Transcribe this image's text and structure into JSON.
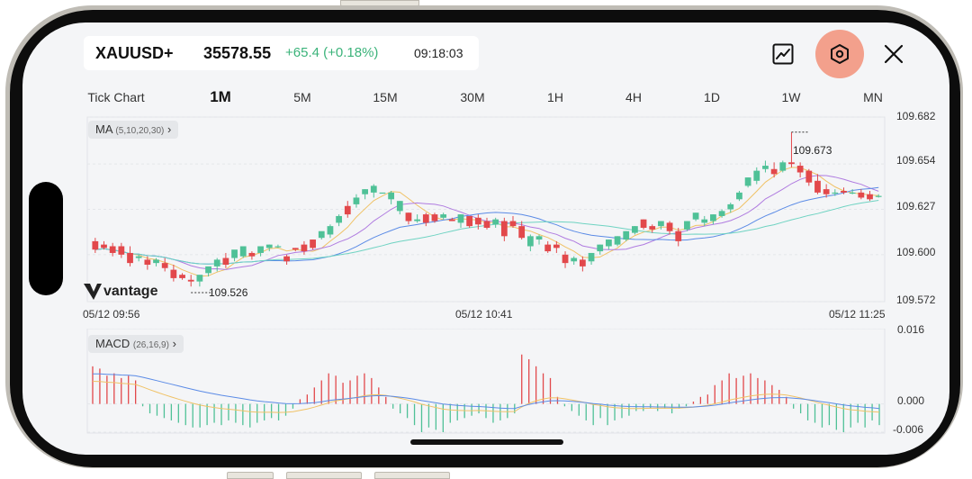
{
  "header": {
    "symbol": "XAUUSD+",
    "price": "35578.55",
    "change": "+65.4 (+0.18%)",
    "time": "09:18:03",
    "change_color": "#3bb37a"
  },
  "toolbar": {
    "chart_icon": "line-chart-icon",
    "settings_icon": "hexagon-settings-icon",
    "close_icon": "close-icon",
    "settings_highlight_color": "#f3a08c"
  },
  "timeframes": {
    "items": [
      "Tick Chart",
      "1M",
      "5M",
      "15M",
      "30M",
      "1H",
      "4H",
      "1D",
      "1W",
      "MN"
    ],
    "active": "1M"
  },
  "main_chart": {
    "indicator_name": "MA",
    "indicator_params": "(5,10,20,30)",
    "watermark": "vantage",
    "high_label": "109.673",
    "low_label": "109.526",
    "price_axis": [
      "109.682",
      "109.654",
      "109.627",
      "109.600",
      "109.572"
    ],
    "time_axis": [
      "05/12 09:56",
      "05/12 10:41",
      "05/12 11:25"
    ],
    "up_color": "#4fc197",
    "down_color": "#e2484b"
  },
  "macd_chart": {
    "indicator_name": "MACD",
    "indicator_params": "(26,16,9)",
    "axis": [
      "0.016",
      "0.000",
      "-0.006"
    ]
  },
  "chart_data": [
    {
      "type": "candlestick",
      "title": "",
      "y_ticks": [
        109.682,
        109.654,
        109.627,
        109.6,
        109.572
      ],
      "ylim": [
        109.572,
        109.682
      ],
      "x_ticks": [
        "05/12 09:56",
        "05/12 10:41",
        "05/12 11:25"
      ],
      "candles": [
        [
          109.608,
          109.603,
          109.61,
          109.601
        ],
        [
          109.606,
          109.604,
          109.608,
          109.603
        ],
        [
          109.605,
          109.601,
          109.607,
          109.599
        ],
        [
          109.605,
          109.6,
          109.607,
          109.598
        ],
        [
          109.601,
          109.595,
          109.605,
          109.593
        ],
        [
          109.598,
          109.599,
          109.6,
          109.596
        ],
        [
          109.597,
          109.594,
          109.599,
          109.591
        ],
        [
          109.595,
          109.597,
          109.598,
          109.593
        ],
        [
          109.595,
          109.592,
          109.598,
          109.59
        ],
        [
          109.591,
          109.586,
          109.594,
          109.584
        ],
        [
          109.588,
          109.586,
          109.589,
          109.585
        ],
        [
          109.585,
          109.584,
          109.588,
          109.581
        ],
        [
          109.584,
          109.588,
          109.586,
          109.581
        ],
        [
          109.589,
          109.593,
          109.591,
          109.587
        ],
        [
          109.593,
          109.597,
          109.598,
          109.59
        ],
        [
          109.598,
          109.594,
          109.601,
          109.592
        ],
        [
          109.598,
          109.603,
          109.6,
          109.596
        ],
        [
          109.599,
          109.605,
          109.605,
          109.598
        ],
        [
          109.601,
          109.599,
          109.602,
          109.597
        ],
        [
          109.601,
          109.605,
          109.605,
          109.599
        ],
        [
          109.604,
          109.606,
          109.606,
          109.602
        ],
        [
          109.605,
          109.605,
          109.606,
          109.604
        ],
        [
          109.599,
          109.596,
          109.6,
          109.594
        ],
        [
          109.604,
          109.603,
          109.604,
          109.602
        ],
        [
          109.606,
          109.602,
          109.608,
          109.6
        ],
        [
          109.609,
          109.604,
          109.609,
          109.603
        ],
        [
          109.61,
          109.614,
          109.612,
          109.609
        ],
        [
          109.612,
          109.617,
          109.618,
          109.61
        ],
        [
          109.619,
          109.623,
          109.624,
          109.617
        ],
        [
          109.629,
          109.624,
          109.632,
          109.622
        ],
        [
          109.63,
          109.634,
          109.636,
          109.628
        ],
        [
          109.636,
          109.639,
          109.639,
          109.633
        ],
        [
          109.637,
          109.641,
          109.642,
          109.634
        ],
        [
          109.637,
          109.637,
          109.637,
          109.637
        ],
        [
          109.633,
          109.637,
          109.638,
          109.63
        ],
        [
          109.626,
          109.632,
          109.632,
          109.624
        ],
        [
          109.625,
          109.62,
          109.625,
          109.618
        ],
        [
          109.62,
          109.621,
          109.624,
          109.619
        ],
        [
          109.624,
          109.619,
          109.625,
          109.617
        ],
        [
          109.624,
          109.62,
          109.625,
          109.619
        ],
        [
          109.622,
          109.624,
          109.625,
          109.621
        ],
        [
          109.621,
          109.62,
          109.622,
          109.62
        ],
        [
          109.619,
          109.624,
          109.624,
          109.616
        ],
        [
          109.623,
          109.617,
          109.623,
          109.616
        ],
        [
          109.622,
          109.618,
          109.624,
          109.615
        ],
        [
          109.62,
          109.616,
          109.622,
          109.615
        ],
        [
          109.618,
          109.621,
          109.622,
          109.616
        ],
        [
          109.62,
          109.611,
          109.622,
          109.608
        ],
        [
          109.62,
          109.617,
          109.623,
          109.616
        ],
        [
          109.617,
          109.61,
          109.62,
          109.609
        ],
        [
          109.605,
          109.611,
          109.612,
          109.602
        ],
        [
          109.609,
          109.611,
          109.612,
          109.606
        ],
        [
          109.606,
          109.602,
          109.608,
          109.601
        ],
        [
          109.606,
          109.604,
          109.608,
          109.601
        ],
        [
          109.6,
          109.595,
          109.602,
          109.592
        ],
        [
          109.596,
          109.598,
          109.599,
          109.594
        ],
        [
          109.597,
          109.593,
          109.599,
          109.59
        ],
        [
          109.596,
          109.601,
          109.601,
          109.594
        ],
        [
          109.602,
          109.606,
          109.606,
          109.6
        ],
        [
          109.605,
          109.609,
          109.609,
          109.603
        ],
        [
          109.606,
          109.611,
          109.611,
          109.605
        ],
        [
          109.609,
          109.614,
          109.614,
          109.608
        ],
        [
          109.613,
          109.617,
          109.617,
          109.612
        ],
        [
          109.621,
          109.616,
          109.621,
          109.615
        ],
        [
          109.617,
          109.615,
          109.618,
          109.613
        ],
        [
          109.617,
          109.62,
          109.62,
          109.615
        ],
        [
          109.619,
          109.614,
          109.62,
          109.612
        ],
        [
          109.614,
          109.608,
          109.616,
          109.605
        ],
        [
          109.615,
          109.62,
          109.62,
          109.614
        ],
        [
          109.621,
          109.625,
          109.625,
          109.62
        ],
        [
          109.619,
          109.621,
          109.623,
          109.617
        ],
        [
          109.62,
          109.624,
          109.624,
          109.618
        ],
        [
          109.623,
          109.626,
          109.627,
          109.622
        ],
        [
          109.627,
          109.63,
          109.631,
          109.625
        ],
        [
          109.633,
          109.637,
          109.638,
          109.632
        ],
        [
          109.641,
          109.646,
          109.646,
          109.64
        ],
        [
          109.644,
          109.65,
          109.652,
          109.642
        ],
        [
          109.651,
          109.653,
          109.656,
          109.649
        ],
        [
          109.651,
          109.648,
          109.655,
          109.646
        ],
        [
          109.65,
          109.655,
          109.656,
          109.649
        ],
        [
          109.655,
          109.654,
          109.673,
          109.652
        ],
        [
          109.653,
          109.649,
          109.655,
          109.646
        ],
        [
          109.65,
          109.643,
          109.651,
          109.641
        ],
        [
          109.644,
          109.637,
          109.648,
          109.636
        ],
        [
          109.639,
          109.636,
          109.642,
          109.634
        ],
        [
          109.637,
          109.637,
          109.639,
          109.635
        ],
        [
          109.638,
          109.637,
          109.64,
          109.636
        ],
        [
          109.637,
          109.637,
          109.639,
          109.636
        ],
        [
          109.637,
          109.634,
          109.639,
          109.633
        ],
        [
          109.636,
          109.633,
          109.638,
          109.632
        ],
        [
          109.635,
          109.635,
          109.636,
          109.634
        ]
      ],
      "candle_format": [
        "open",
        "close",
        "high",
        "low"
      ],
      "moving_averages": [
        "MA5",
        "MA10",
        "MA20",
        "MA30"
      ],
      "high_marker": 109.673,
      "low_marker": 109.526
    },
    {
      "type": "bar",
      "title": "MACD (26,16,9)",
      "y_ticks": [
        0.016,
        0.0,
        -0.006
      ],
      "ylim": [
        -0.006,
        0.016
      ],
      "values": [
        0.008,
        0.0075,
        0.006,
        0.0065,
        0.0055,
        0.006,
        0.005,
        -0.0005,
        -0.002,
        -0.0025,
        -0.003,
        -0.0035,
        -0.004,
        -0.0045,
        -0.005,
        -0.005,
        -0.0045,
        -0.004,
        -0.0045,
        -0.0035,
        -0.004,
        -0.0045,
        -0.005,
        -0.004,
        -0.0035,
        -0.003,
        -0.0035,
        -0.0025,
        -0.001,
        0.001,
        0.002,
        0.0035,
        0.005,
        0.0065,
        0.006,
        0.0045,
        0.005,
        0.006,
        0.0065,
        0.0055,
        0.0035,
        0.0015,
        -0.001,
        -0.002,
        -0.003,
        -0.0045,
        -0.006,
        -0.005,
        -0.0055,
        -0.006,
        -0.004,
        -0.0035,
        -0.003,
        -0.0025,
        -0.002,
        -0.003,
        -0.004,
        -0.0035,
        -0.003,
        -0.002,
        0.0105,
        0.0095,
        0.008,
        0.0065,
        0.0055,
        0.0015,
        -0.0005,
        -0.0015,
        -0.0025,
        -0.0035,
        -0.0045,
        -0.003,
        -0.0045,
        -0.0035,
        -0.003,
        -0.0025,
        -0.0015,
        -0.0015,
        -0.001,
        -0.0015,
        -0.001,
        -0.002,
        -0.001,
        -0.0005,
        0.0005,
        0.0015,
        0.002,
        0.004,
        0.005,
        0.0065,
        0.0055,
        0.006,
        0.0065,
        0.0055,
        0.005,
        0.004,
        0.003,
        0.0015,
        -0.001,
        -0.002,
        -0.0035,
        -0.004,
        -0.005,
        -0.0045,
        -0.0055,
        -0.006,
        -0.005,
        -0.004,
        -0.005,
        -0.0035,
        -0.0045
      ]
    }
  ]
}
